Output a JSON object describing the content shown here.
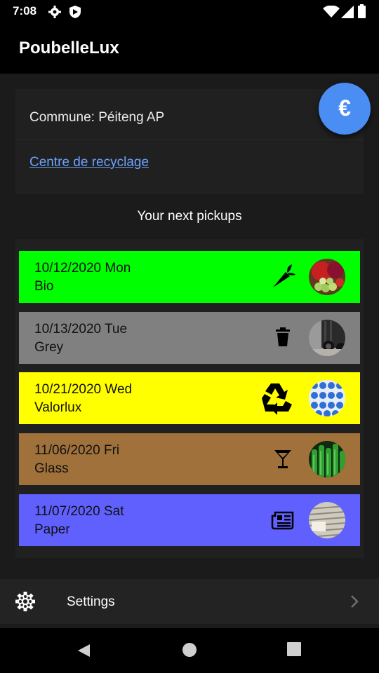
{
  "status_bar": {
    "time": "7:08",
    "icons": [
      "settings-icon",
      "shield-icon",
      "wifi-icon",
      "signal-icon",
      "battery-icon"
    ]
  },
  "app": {
    "title": "PoubelleLux"
  },
  "commune": {
    "label": "Commune: Péiteng AP",
    "recycling_link": "Centre de recyclage"
  },
  "fab": {
    "glyph": "€",
    "icon": "euro-icon"
  },
  "pickups": {
    "title": "Your next pickups",
    "items": [
      {
        "date": "10/12/2020 Mon",
        "type": "Bio",
        "color": "#00ff00",
        "icon": "carrot-icon"
      },
      {
        "date": "10/13/2020 Tue",
        "type": "Grey",
        "color": "#808080",
        "icon": "trash-icon"
      },
      {
        "date": "10/21/2020 Wed",
        "type": "Valorlux",
        "color": "#ffff00",
        "icon": "recycle-icon"
      },
      {
        "date": "11/06/2020 Fri",
        "type": "Glass",
        "color": "#a0713a",
        "icon": "cocktail-glass-icon"
      },
      {
        "date": "11/07/2020 Sat",
        "type": "Paper",
        "color": "#6060ff",
        "icon": "newspaper-icon"
      }
    ]
  },
  "settings": {
    "label": "Settings",
    "icon": "gear-icon"
  },
  "nav": {
    "buttons": [
      "back-icon",
      "home-icon",
      "recents-icon"
    ]
  }
}
